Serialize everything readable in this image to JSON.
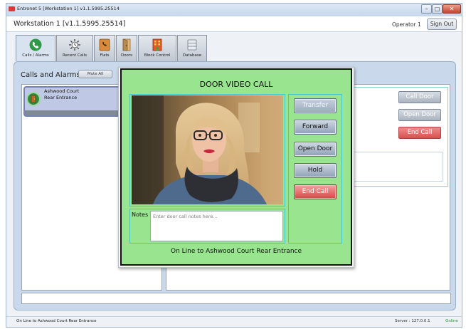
{
  "window": {
    "title": "Entronet 5 [Workstation 1] v1.1.5995.25514",
    "controls": {
      "minimize": "–",
      "maximize": "□",
      "close": "✕"
    }
  },
  "header": {
    "workstation_title": "Workstation 1 [v1.1.5995.25514]",
    "operator": "Operator 1",
    "sign_out_label": "Sign Out"
  },
  "tabs": [
    {
      "label": "Calls / Alarms",
      "icon": "phone-icon",
      "active": true
    },
    {
      "label": "Recent Calls",
      "icon": "clock-icon"
    },
    {
      "label": "Flats",
      "icon": "handset-book-icon"
    },
    {
      "label": "Doors",
      "icon": "door-icon"
    },
    {
      "label": "Block Control",
      "icon": "building-icon"
    },
    {
      "label": "Database",
      "icon": "database-icon"
    }
  ],
  "calls_panel": {
    "heading": "Calls and Alarms",
    "mute_all_label": "Mute All",
    "active_call": {
      "line1": "Ashwood Court",
      "line2": "Rear Entrance",
      "icon": "door-call-icon"
    }
  },
  "right_panel": {
    "call_door_label": "Call Door",
    "open_door_label": "Open Door",
    "end_call_label": "End Call"
  },
  "dialog": {
    "title": "DOOR VIDEO CALL",
    "notes_label": "Notes",
    "notes_placeholder": "Enter door call notes here...",
    "buttons": {
      "transfer": "Transfer",
      "forward": "Forward",
      "open_door": "Open Door",
      "hold": "Hold",
      "end_call": "End Call"
    },
    "status_text": "On Line to Ashwood Court Rear Entrance",
    "video_feed": "door-camera-video"
  },
  "statusbar": {
    "left_text": "On Line to Ashwood Court Rear Entrance",
    "server_text": "Server : 127.0.0.1",
    "online_text": "Online"
  },
  "colors": {
    "dialog_green": "#99e58f",
    "end_call_red": "#d74646",
    "online_green": "#1b9a2a",
    "content_blue": "#c9d8ea"
  }
}
